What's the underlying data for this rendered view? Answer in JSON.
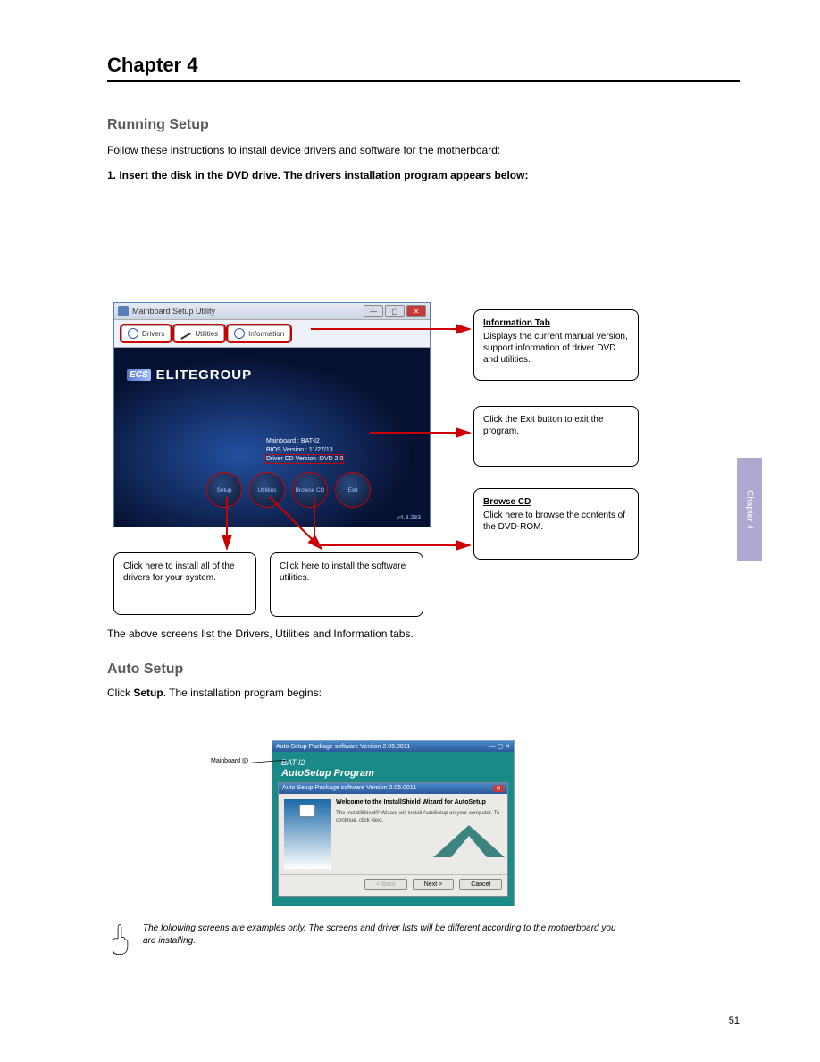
{
  "chapter": {
    "title": "Chapter 4"
  },
  "sections": {
    "running_setup": {
      "heading": "Running Setup"
    },
    "body1": "Follow these instructions to install device drivers and software for the motherboard:",
    "body2": "1. Insert the disk in the DVD drive. The drivers installation program appears below:",
    "body3": "The above screens list the Drivers, Utilities and Information tabs.",
    "autorun": {
      "heading": "Auto Setup",
      "click_setup": "Click Setup. The installation program begins:",
      "note": "The following screens are examples only. The screens and driver lists will be different according to the motherboard you are installing."
    }
  },
  "utility_window": {
    "title": "Mainboard Setup Utility",
    "tabs": {
      "drivers": "Drivers",
      "utilities": "Utilities",
      "information": "Information"
    },
    "brand": {
      "logo": "ECS",
      "name": "ELITEGROUP"
    },
    "info": {
      "mb_label": "Mainboard :",
      "mb_value": "BAT-I2",
      "bios_label": "BIOS Version :",
      "bios_value": "11/27/13",
      "cd_label": "Driver CD Version :",
      "cd_value": "DVD 2.0"
    },
    "buttons": {
      "setup": "Setup",
      "utilities": "Utilities",
      "browse": "Browse CD",
      "exit": "Exit"
    },
    "version": "v4.3.283"
  },
  "callouts": {
    "c1": {
      "heading": "Information Tab",
      "body": "Displays the current manual version, support information of driver DVD and utilities."
    },
    "c2": {
      "body": "Click the Exit button to exit the program."
    },
    "c3": {
      "heading": "Browse CD",
      "body": "Click here to browse the contents of the DVD-ROM."
    },
    "c4": {
      "body": "Click here to install all of the drivers for your system."
    },
    "c5": {
      "body": "Click here to install the software utilities."
    }
  },
  "setup_window": {
    "outer_title": "Auto Setup Package software Version 2.05.0011",
    "bat": "BAT-I2",
    "program": "AutoSetup Program",
    "inner_title": "Auto Setup Package software Version 2.05.0011",
    "welcome_h": "Welcome to the InstallShield Wizard for AutoSetup",
    "welcome_p": "The InstallShield® Wizard will install AutoSetup on your computer. To continue, click Next.",
    "back": "< Back",
    "next": "Next >",
    "cancel": "Cancel",
    "mb_id_label": "Mainboard ID"
  },
  "sidebar": {
    "label": "Chapter 4"
  },
  "pagenum": "51"
}
